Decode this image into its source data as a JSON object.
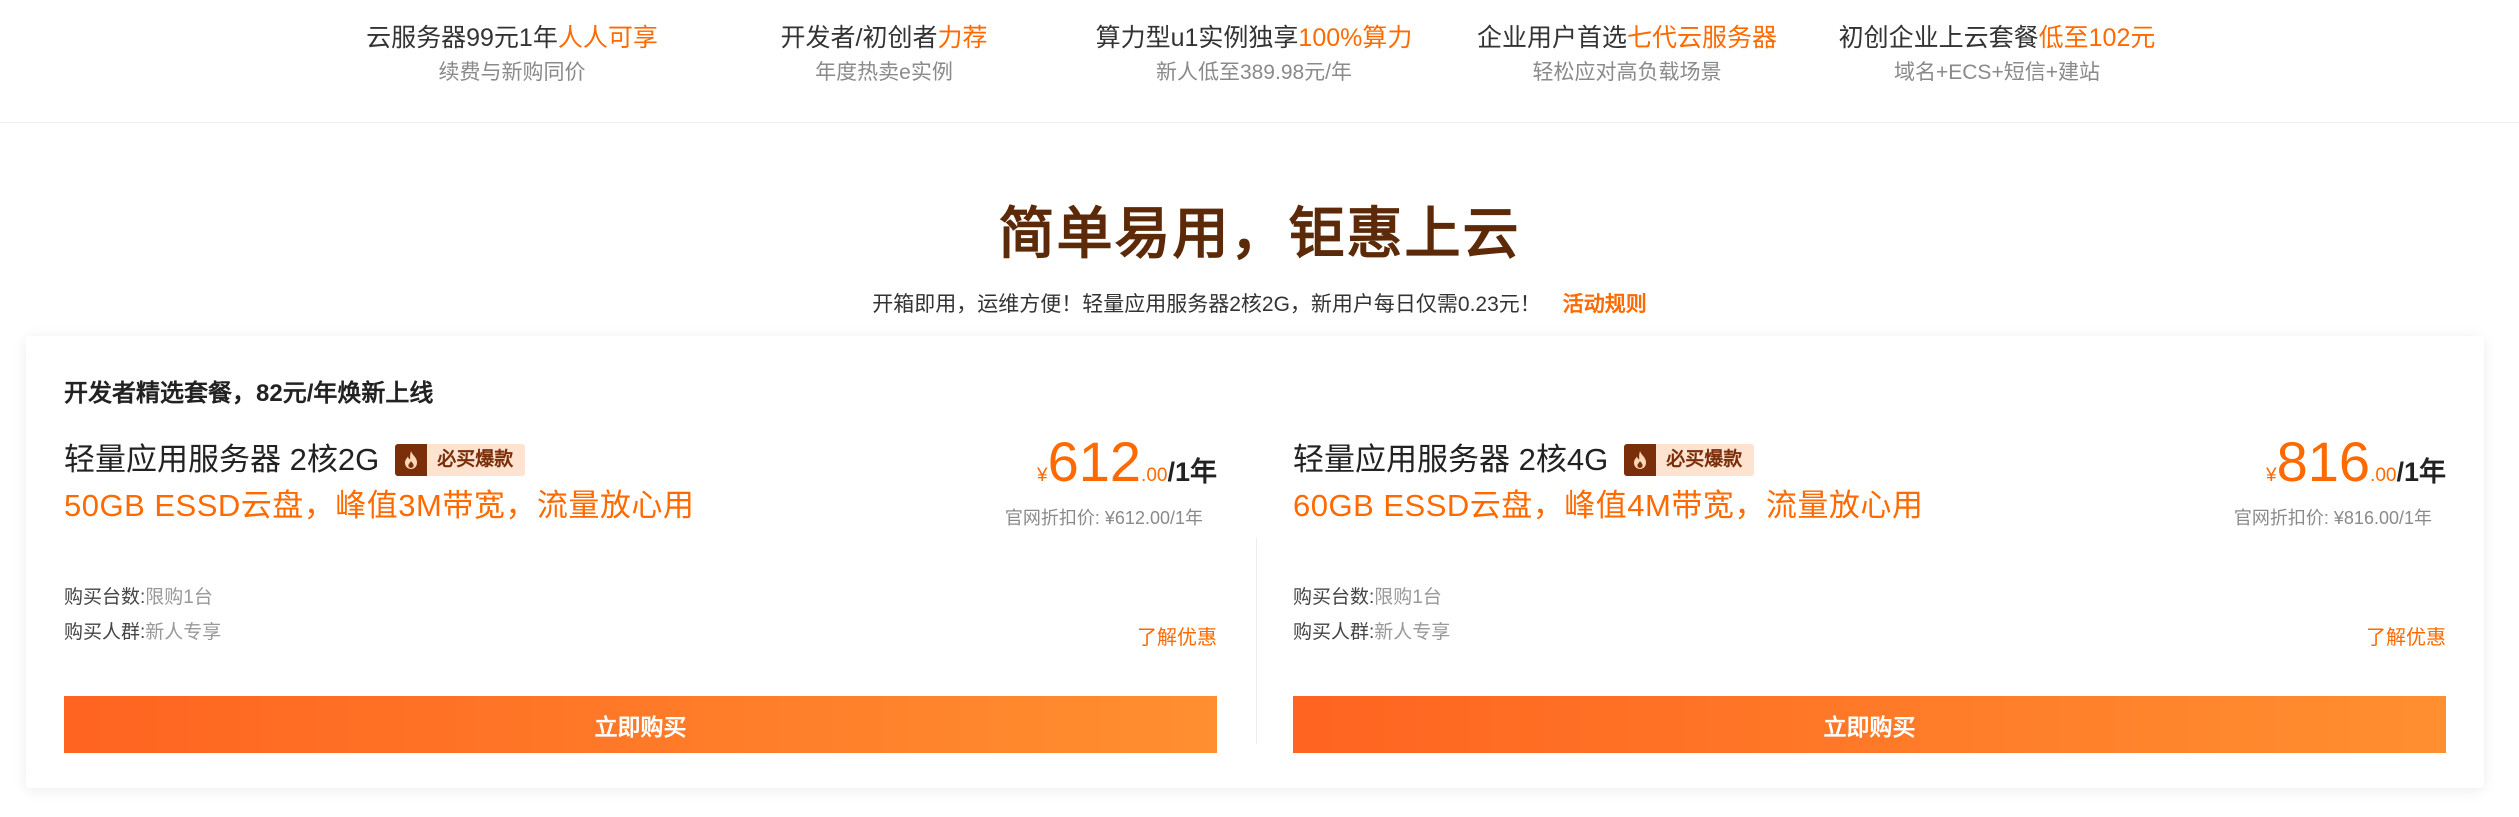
{
  "promos": [
    {
      "title": "云服务器99元1年",
      "highlight": "人人可享",
      "sub": "续费与新购同价"
    },
    {
      "title": "开发者/初创者",
      "highlight": "力荐",
      "sub": "年度热卖e实例"
    },
    {
      "title": "算力型u1实例独享",
      "highlight": "100%算力",
      "sub": "新人低至389.98元/年"
    },
    {
      "title": "企业用户首选",
      "highlight": "七代云服务器",
      "sub": "轻松应对高负载场景"
    },
    {
      "title": "初创企业上云套餐",
      "highlight": "低至102元",
      "sub": "域名+ECS+短信+建站"
    }
  ],
  "headline": "简单易用，钜惠上云",
  "subline": {
    "text": "开箱即用，运维方便！轻量应用服务器2核2G，新用户每日仅需0.23元！",
    "link": "活动规则"
  },
  "panel": {
    "title": "开发者精选套餐，82元/年焕新上线",
    "products": [
      {
        "name": "轻量应用服务器 2核2G",
        "badge": "必买爆款",
        "spec": "50GB ESSD云盘，峰值3M带宽，流量放心用",
        "currency": "¥",
        "price_int": "612",
        "price_dec": ".00",
        "unit": "/1年",
        "official": "官网折扣价: ¥612.00/1年",
        "qty_label": "购买台数:",
        "qty_value": "限购1台",
        "crowd_label": "购买人群:",
        "crowd_value": "新人专享",
        "learn_more": "了解优惠",
        "buy": "立即购买"
      },
      {
        "name": "轻量应用服务器 2核4G",
        "badge": "必买爆款",
        "spec": "60GB ESSD云盘，峰值4M带宽，流量放心用",
        "currency": "¥",
        "price_int": "816",
        "price_dec": ".00",
        "unit": "/1年",
        "official": "官网折扣价: ¥816.00/1年",
        "qty_label": "购买台数:",
        "qty_value": "限购1台",
        "crowd_label": "购买人群:",
        "crowd_value": "新人专享",
        "learn_more": "了解优惠",
        "buy": "立即购买"
      }
    ]
  },
  "colors": {
    "accent": "#ff6a00",
    "headline": "#5c2a08",
    "badge_dark": "#7a2e0a",
    "badge_light": "#fde3d0"
  },
  "icons": {
    "badge": "flame-icon"
  }
}
